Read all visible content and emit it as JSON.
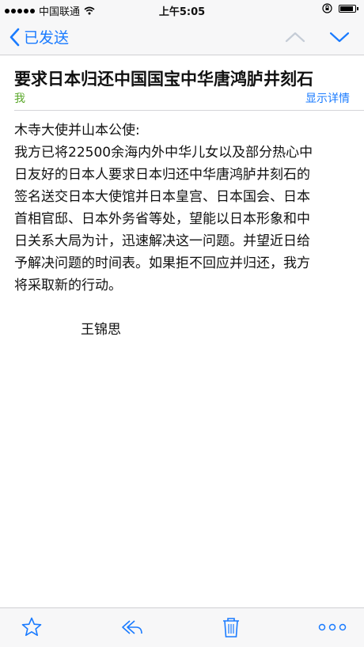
{
  "status_bar": {
    "carrier": "中国联通",
    "time": "上午5:05",
    "icons": [
      "signal-dots-icon",
      "wifi-icon",
      "rotation-lock-icon",
      "battery-icon"
    ],
    "battery_level": 0.9
  },
  "nav": {
    "back_label": "已发送",
    "icons": [
      "chevron-left-icon",
      "chevron-up-icon",
      "chevron-down-icon"
    ]
  },
  "email": {
    "subject": "要求日本归还中国国宝中华唐鸿胪井刻石",
    "sender": "我",
    "details_link": "显示详情",
    "greeting": "木寺大使并山本公使:",
    "body_lines": [
      "我方已将22500余海内外中华儿女以及部分热心中",
      "日友好的日本人要求日本归还中华唐鸿胪井刻石的",
      "签名送交日本大使馆并日本皇宫、日本国会、日本",
      "首相官邸、日本外务省等处，望能以日本形象和中",
      "日关系大局为计，迅速解决这一问题。并望近日给",
      "予解决问题的时间表。如果拒不回应并归还，我方",
      "将采取新的行动。"
    ],
    "signature": "王锦思"
  },
  "toolbar": {
    "icons": [
      "star-icon",
      "reply-icon",
      "trash-icon",
      "more-icon"
    ]
  },
  "colors": {
    "accent": "#1a7bff",
    "sender": "#5aa82a",
    "bar_background": "#f7f7f8"
  }
}
